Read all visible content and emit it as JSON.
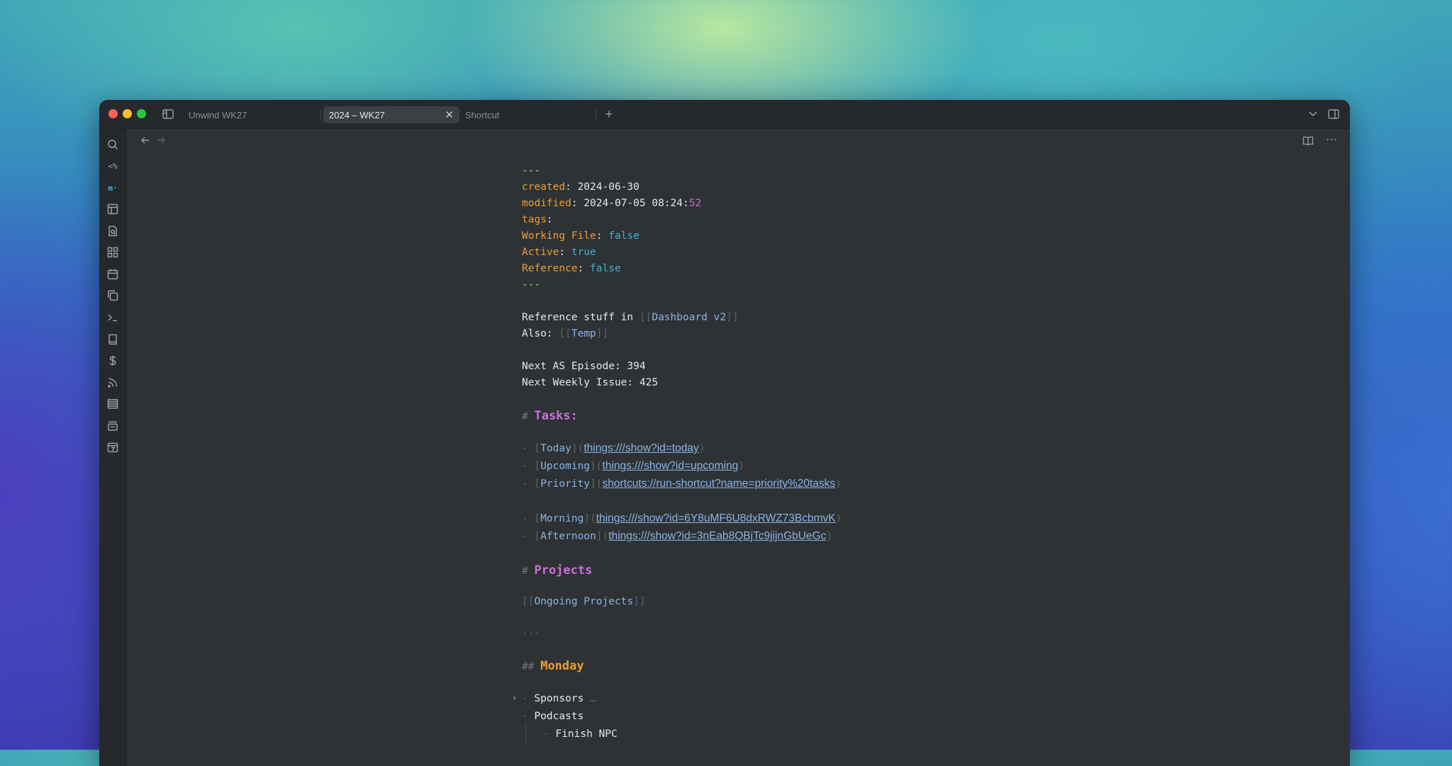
{
  "tabs": [
    {
      "label": "Unwind WK27",
      "active": false
    },
    {
      "label": "2024 – WK27",
      "active": true
    },
    {
      "label": "Shortcut",
      "active": false
    }
  ],
  "ribbon_icons": [
    "search-icon",
    "templater-icon",
    "mono-icon",
    "layout-icon",
    "file-search-icon",
    "grid-icon",
    "calendar-icon",
    "copy-icon",
    "terminal-icon",
    "book-icon",
    "dollar-icon",
    "rss-icon",
    "list-icon",
    "queue-icon",
    "calendar-7-icon"
  ],
  "ribbon_text": {
    "templater": "<%",
    "mono": "m·"
  },
  "frontmatter": {
    "delim": "---",
    "created_key": "created",
    "created_val": "2024-06-30",
    "modified_key": "modified",
    "modified_val": "2024-07-05 08:24:",
    "modified_sec": "52",
    "tags_key": "tags",
    "working_key": "Working File",
    "working_val": "false",
    "active_key": "Active",
    "active_val": "true",
    "reference_key": "Reference",
    "reference_val": "false"
  },
  "body": {
    "ref_prefix": "Reference stuff in ",
    "ref_link": "Dashboard v2",
    "also_prefix": "Also: ",
    "also_link": "Temp",
    "next_as": "Next AS Episode: 394",
    "next_weekly": "Next Weekly Issue: 425",
    "tasks_heading": "Tasks:",
    "tasks": [
      {
        "label": "Today",
        "url": "things:///show?id=today"
      },
      {
        "label": "Upcoming",
        "url": "things:///show?id=upcoming"
      },
      {
        "label": "Priority",
        "url": "shortcuts://run-shortcut?name=priority%20tasks"
      },
      {
        "label": "Morning",
        "url": "things:///show?id=6Y8uMF6U8dxRWZ73BcbmvK"
      },
      {
        "label": "Afternoon",
        "url": "things:///show?id=3nEab8QBjTc9jijnGbUeGc"
      }
    ],
    "projects_heading": "Projects",
    "projects_link": "Ongoing Projects",
    "hr": "---",
    "monday_heading": "Monday",
    "monday_items": [
      "Sponsors",
      "Podcasts",
      "Finish NPC"
    ],
    "ellipsis": "…"
  }
}
